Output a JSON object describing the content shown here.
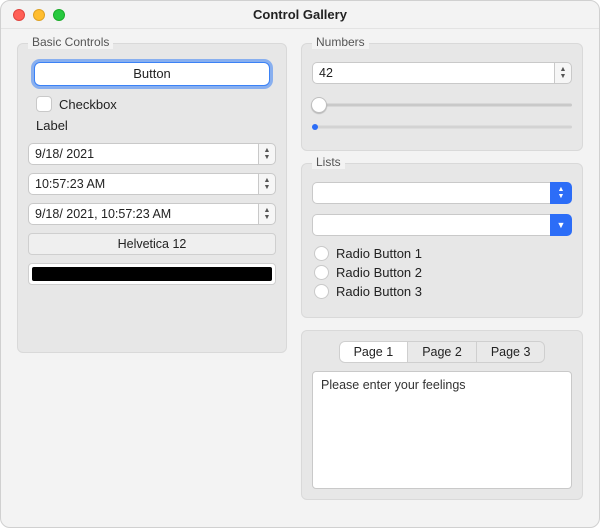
{
  "window": {
    "title": "Control Gallery"
  },
  "basic": {
    "group_label": "Basic Controls",
    "button_label": "Button",
    "checkbox_label": "Checkbox",
    "label_text": "Label",
    "date_value": "9/18/ 2021",
    "time_value": "10:57:23 AM",
    "datetime_value": "9/18/ 2021, 10:57:23 AM",
    "font_label": "Helvetica 12",
    "color_value": "#000000"
  },
  "numbers": {
    "group_label": "Numbers",
    "spin_value": "42",
    "slider_value": 0,
    "progress_value": 0
  },
  "lists": {
    "group_label": "Lists",
    "combo1_value": "",
    "combo2_value": "",
    "radio1": "Radio Button 1",
    "radio2": "Radio Button 2",
    "radio3": "Radio Button 3"
  },
  "tabs": {
    "tab1": "Page 1",
    "tab2": "Page 2",
    "tab3": "Page 3",
    "textarea_value": "Please enter your feelings"
  }
}
